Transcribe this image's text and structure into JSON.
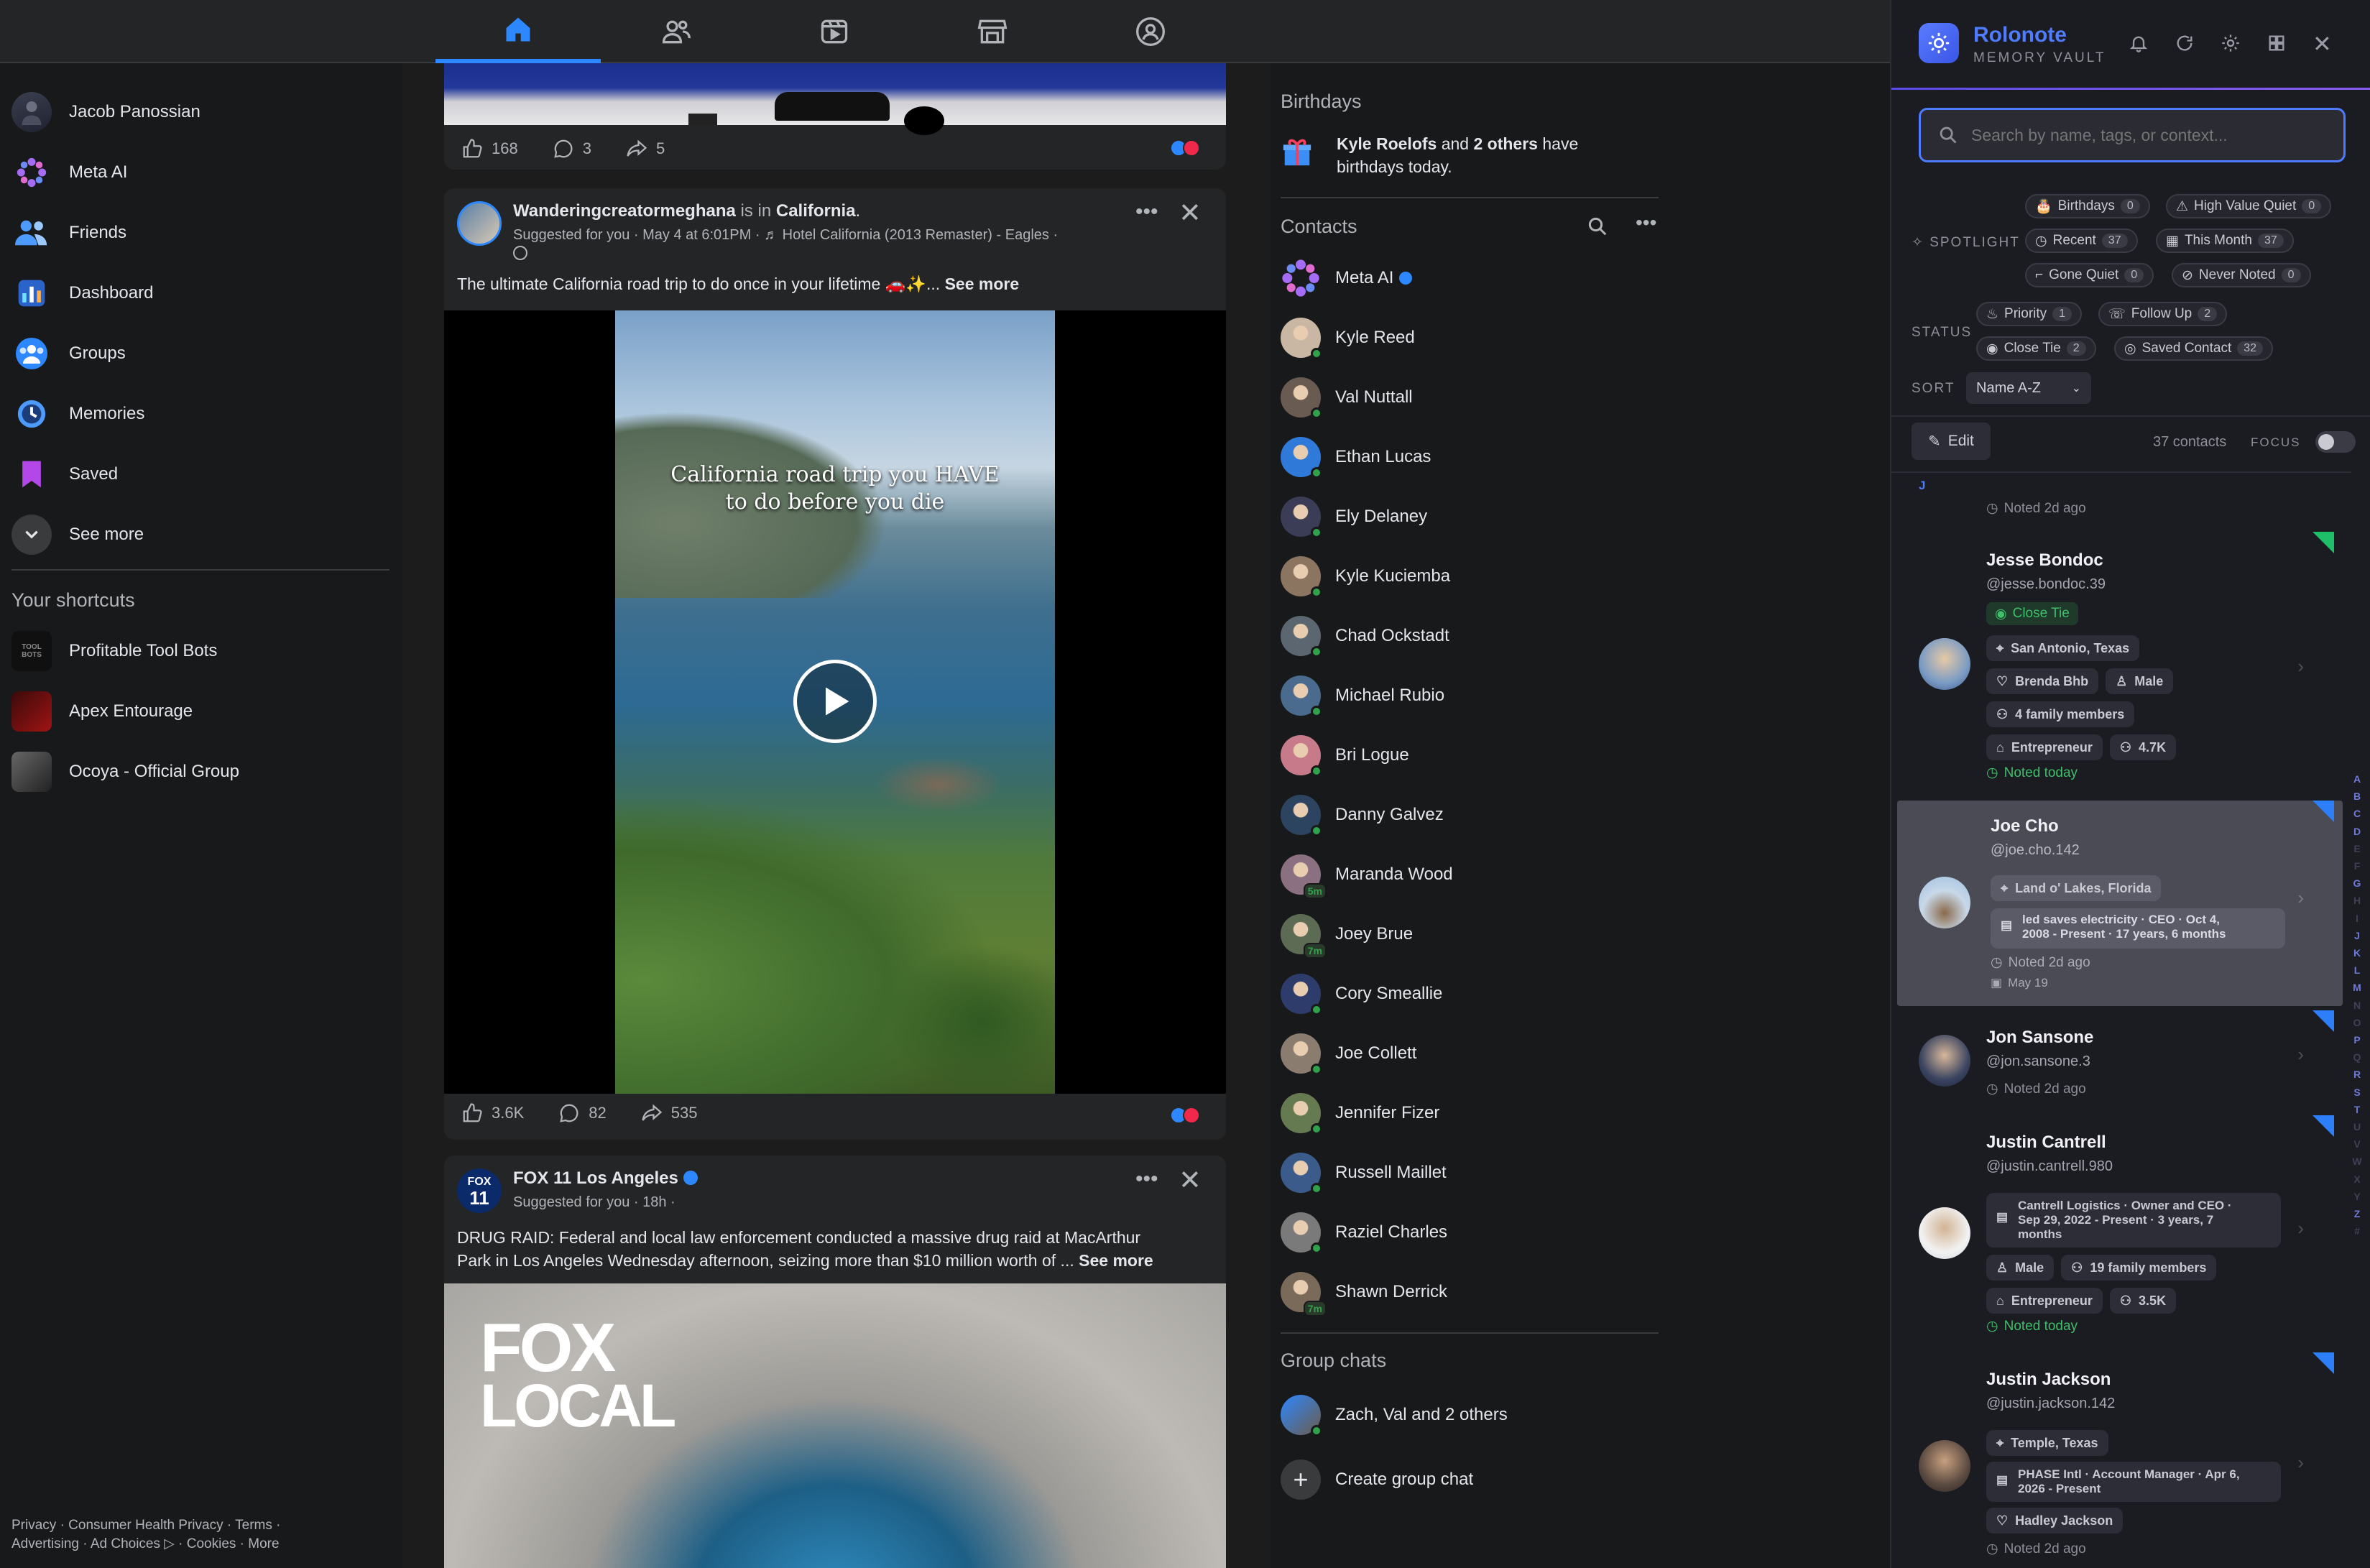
{
  "nav_tabs": [
    "home-icon",
    "friends-icon",
    "video-icon",
    "marketplace-icon",
    "groups-icon"
  ],
  "left_nav": {
    "items": [
      {
        "label": "Jacob Panossian",
        "icon": "avatar"
      },
      {
        "label": "Meta AI",
        "icon": "meta-ai-icon"
      },
      {
        "label": "Friends",
        "icon": "friends-icon"
      },
      {
        "label": "Dashboard",
        "icon": "dashboard-icon"
      },
      {
        "label": "Groups",
        "icon": "groups-icon"
      },
      {
        "label": "Memories",
        "icon": "memories-icon"
      },
      {
        "label": "Saved",
        "icon": "saved-icon"
      },
      {
        "label": "See more",
        "icon": "chevron-down-icon"
      }
    ],
    "shortcuts_title": "Your shortcuts",
    "shortcuts": [
      "Profitable Tool Bots",
      "Apex Entourage",
      "Ocoya - Official Group"
    ],
    "footer_line1": "Privacy · Consumer Health Privacy · Terms ·",
    "footer_line2": "Advertising · Ad Choices ▷ · Cookies · More"
  },
  "feed": {
    "post0": {
      "likes": "168",
      "comments": "3",
      "shares": "5"
    },
    "post1": {
      "author": "Wanderingcreatormeghana",
      "is_in": " is in ",
      "location": "California",
      "location_suffix": ".",
      "meta": "Suggested for you · May 4 at 6:01PM · ♬ Hotel California (2013 Remaster) - Eagles ·",
      "text": "The ultimate California road trip to do once in your lifetime 🚗✨...",
      "see_more": "See more",
      "video_caption_1": "California road trip you HAVE",
      "video_caption_2": "to do before you die",
      "likes": "3.6K",
      "comments": "82",
      "shares": "535"
    },
    "post2": {
      "author": "FOX 11 Los Angeles",
      "meta": "Suggested for you · 18h ·",
      "text1": "DRUG RAID: Federal and local law enforcement conducted a massive drug raid at MacArthur",
      "text2": "Park in Los Angeles Wednesday afternoon, seizing more than $10 million worth of ...",
      "see_more": "See more",
      "logo_line1": "FOX",
      "logo_line2": "LOCAL",
      "avatar_text_1": "FOX",
      "avatar_text_2": "11"
    }
  },
  "right_col": {
    "birthdays_title": "Birthdays",
    "birthday_names": "Kyle Roelofs",
    "birthday_and": " and ",
    "birthday_others": "2 others",
    "birthday_rest": " have",
    "birthday_line2": "birthdays today.",
    "contacts_title": "Contacts",
    "contacts": [
      {
        "name": "Meta AI",
        "color": "#9b6cf0"
      },
      {
        "name": "Kyle Reed",
        "color": "#c9b7a3"
      },
      {
        "name": "Val Nuttall",
        "color": "#6a5b52"
      },
      {
        "name": "Ethan Lucas",
        "color": "#2f7ad9"
      },
      {
        "name": "Ely Delaney",
        "color": "#3a3d55"
      },
      {
        "name": "Kyle Kuciemba",
        "color": "#8c7560"
      },
      {
        "name": "Chad Ockstadt",
        "color": "#5b6670"
      },
      {
        "name": "Michael Rubio",
        "color": "#4a6b8e"
      },
      {
        "name": "Bri Logue",
        "color": "#c77b8a"
      },
      {
        "name": "Danny Galvez",
        "color": "#2d4460"
      },
      {
        "name": "Maranda Wood",
        "color": "#8a7080",
        "time": "5m"
      },
      {
        "name": "Joey Brue",
        "color": "#5d6b55",
        "time": "7m"
      },
      {
        "name": "Cory Smeallie",
        "color": "#2d3c6a"
      },
      {
        "name": "Joe Collett",
        "color": "#8a7d70"
      },
      {
        "name": "Jennifer Fizer",
        "color": "#667a52"
      },
      {
        "name": "Russell Maillet",
        "color": "#3b5b8a"
      },
      {
        "name": "Raziel Charles",
        "color": "#7a7a7a"
      },
      {
        "name": "Shawn Derrick",
        "color": "#7a6a5a",
        "time": "7m"
      }
    ],
    "group_chats_title": "Group chats",
    "group_chat": "Zach, Val and 2 others",
    "create_group": "Create group chat"
  },
  "ext": {
    "title": "Rolonote",
    "subtitle": "MEMORY VAULT",
    "search_placeholder": "Search by name, tags, or context...",
    "spotlight_label": "SPOTLIGHT",
    "spotlight_chips": [
      {
        "label": "Birthdays",
        "count": "0"
      },
      {
        "label": "High Value Quiet",
        "count": "0"
      },
      {
        "label": "Recent",
        "count": "37"
      },
      {
        "label": "This Month",
        "count": "37"
      },
      {
        "label": "Gone Quiet",
        "count": "0"
      },
      {
        "label": "Never Noted",
        "count": "0"
      }
    ],
    "status_label": "STATUS",
    "status_chips": [
      {
        "label": "Priority",
        "count": "1"
      },
      {
        "label": "Follow Up",
        "count": "2"
      },
      {
        "label": "Close Tie",
        "count": "2"
      },
      {
        "label": "Saved Contact",
        "count": "32"
      }
    ],
    "sort_label": "SORT",
    "sort_value": "Name A-Z",
    "edit_label": "Edit",
    "contacts_count": "37 contacts",
    "focus_label": "FOCUS",
    "section_letter": "J",
    "top_noted": "Noted 2d ago",
    "cards": [
      {
        "name": "Jesse Bondoc",
        "handle": "@jesse.bondoc.39",
        "badge": "Close Tie",
        "loc": "San Antonio, Texas",
        "rel": "Brenda Bhb",
        "gender": "Male",
        "family": "4 family members",
        "job": "Entrepreneur",
        "followers": "4.7K",
        "noted": "Noted today"
      },
      {
        "name": "Joe Cho",
        "handle": "@joe.cho.142",
        "loc": "Land o' Lakes, Florida",
        "work1": "led saves electricity · CEO · Oct 4,",
        "work2": "2008 - Present · 17 years, 6 months",
        "noted": "Noted 2d ago",
        "bday": "May 19"
      },
      {
        "name": "Jon Sansone",
        "handle": "@jon.sansone.3",
        "noted": "Noted 2d ago"
      },
      {
        "name": "Justin Cantrell",
        "handle": "@justin.cantrell.980",
        "work1": "Cantrell Logistics · Owner and CEO ·",
        "work2": "Sep 29, 2022 - Present · 3 years, 7",
        "work3": "months",
        "gender": "Male",
        "family": "19 family members",
        "job": "Entrepreneur",
        "followers": "3.5K",
        "noted": "Noted today"
      },
      {
        "name": "Justin Jackson",
        "handle": "@justin.jackson.142",
        "loc": "Temple, Texas",
        "work1": "PHASE Intl · Account Manager · Apr 6,",
        "work2": "2026 - Present",
        "rel": "Hadley Jackson",
        "noted": "Noted 2d ago"
      }
    ],
    "alphabet": [
      "A",
      "B",
      "C",
      "D",
      "E",
      "F",
      "G",
      "H",
      "I",
      "J",
      "K",
      "L",
      "M",
      "N",
      "O",
      "P",
      "Q",
      "R",
      "S",
      "T",
      "U",
      "V",
      "W",
      "X",
      "Y",
      "Z",
      "#"
    ]
  },
  "colors": {
    "accent": "#2d88ff",
    "ext_accent": "#4f7cff",
    "online": "#31a24c",
    "noted_today": "#3fbf6a"
  }
}
